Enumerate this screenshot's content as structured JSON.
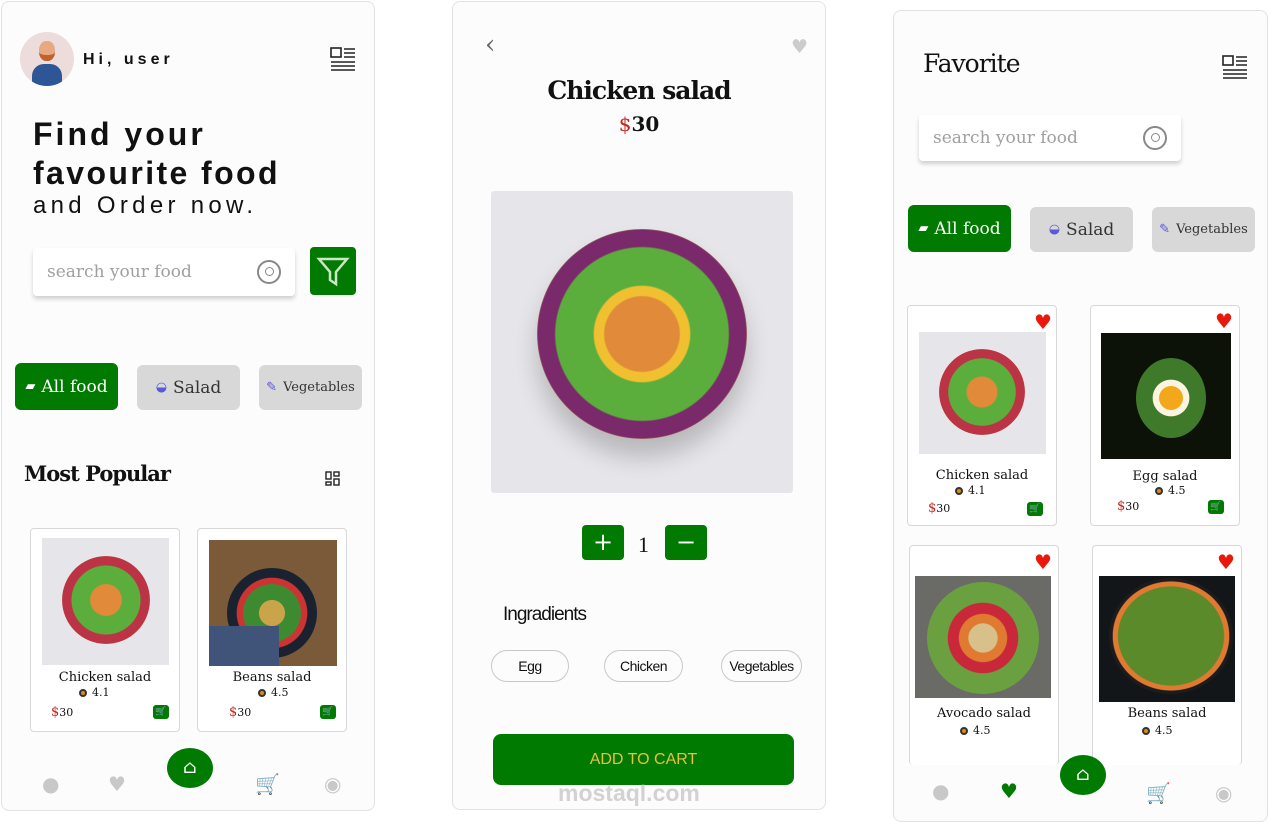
{
  "colors": {
    "accent": "#007a00",
    "price": "#c0281e",
    "heart": "#e8180c"
  },
  "home": {
    "greeting": "Hi, user",
    "headline_1": "Find your",
    "headline_2": "favourite food",
    "headline_3": "and Order now.",
    "search_placeholder": "search your food",
    "categories": [
      {
        "label": "All food",
        "icon": "chef-hat-icon"
      },
      {
        "label": "Salad",
        "icon": "salad-bowl-icon"
      },
      {
        "label": "Vegetables",
        "icon": "carrot-icon"
      }
    ],
    "section_title": "Most Popular",
    "items": [
      {
        "name": "Chicken salad",
        "rating": "4.1",
        "currency": "$",
        "price": "30"
      },
      {
        "name": "Beans salad",
        "rating": "4.5",
        "currency": "$",
        "price": "30"
      }
    ]
  },
  "detail": {
    "title": "Chicken salad",
    "currency": "$",
    "price": "30",
    "quantity": "1",
    "plus": "+",
    "minus": "−",
    "ingredients_title": "Ingradients",
    "ingredients": [
      "Egg",
      "Chicken",
      "Vegetables"
    ],
    "add_to_cart": "ADD TO CART",
    "watermark": "mostaql.com"
  },
  "favorite": {
    "title": "Favorite",
    "search_placeholder": "search your food",
    "categories": [
      {
        "label": "All food"
      },
      {
        "label": "Salad"
      },
      {
        "label": "Vegetables"
      }
    ],
    "items": [
      {
        "name": "Chicken salad",
        "rating": "4.1",
        "currency": "$",
        "price": "30"
      },
      {
        "name": "Egg salad",
        "rating": "4.5",
        "currency": "$",
        "price": "30"
      },
      {
        "name": "Avocado salad",
        "rating": "4.5"
      },
      {
        "name": "Beans salad",
        "rating": "4.5"
      }
    ]
  }
}
